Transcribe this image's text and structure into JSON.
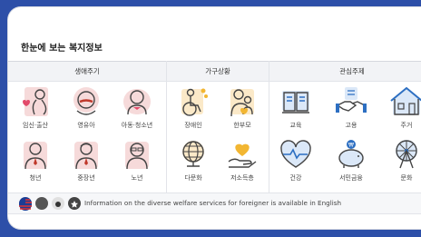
{
  "title": "한눈에 보는 복지정보",
  "headers": {
    "life": "생애주기",
    "household": "가구상황",
    "interest": "관심주제"
  },
  "life_items": [
    {
      "label": "임신·출산",
      "icon": "pregnancy-icon"
    },
    {
      "label": "영유아",
      "icon": "infant-icon"
    },
    {
      "label": "아동·청소년",
      "icon": "child-icon"
    },
    {
      "label": "청년",
      "icon": "youth-icon"
    },
    {
      "label": "중장년",
      "icon": "middle-aged-icon"
    },
    {
      "label": "노년",
      "icon": "senior-icon"
    }
  ],
  "household_items": [
    {
      "label": "장애인",
      "icon": "wheelchair-icon"
    },
    {
      "label": "한부모",
      "icon": "single-parent-icon"
    },
    {
      "label": "다문화",
      "icon": "globe-icon"
    },
    {
      "label": "저소득층",
      "icon": "heart-hand-icon"
    }
  ],
  "interest_items": [
    {
      "label": "교육",
      "icon": "book-icon"
    },
    {
      "label": "고용",
      "icon": "handshake-icon"
    },
    {
      "label": "주거",
      "icon": "house-icon"
    },
    {
      "label": "건강",
      "icon": "heartbeat-icon"
    },
    {
      "label": "서민금융",
      "icon": "piggy-bank-icon"
    },
    {
      "label": "문화",
      "icon": "ferris-wheel-icon"
    }
  ],
  "footer": {
    "text": "Information on the diverse welfare services for foreigner is available in English"
  },
  "colors": {
    "accent": "#e6c6c6",
    "brand_blue": "#2d4fa8"
  }
}
